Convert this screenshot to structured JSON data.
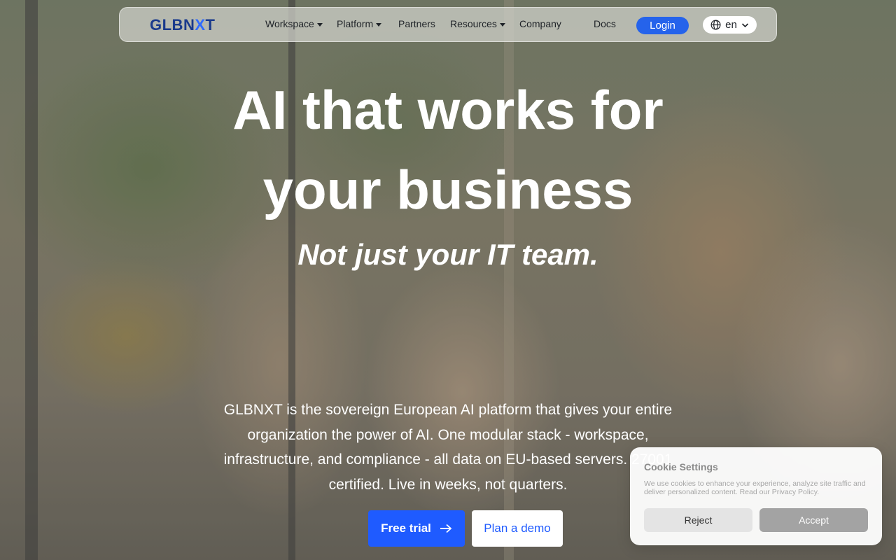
{
  "nav": {
    "logo_main": "GLBN",
    "logo_x": "X",
    "logo_end": "T",
    "items": [
      {
        "label": "Workspace",
        "has_dropdown": true
      },
      {
        "label": "Platform",
        "has_dropdown": true
      },
      {
        "label": "Partners",
        "has_dropdown": false
      },
      {
        "label": "Resources",
        "has_dropdown": true
      },
      {
        "label": "Company",
        "has_dropdown": false
      }
    ],
    "docs_label": "Docs",
    "login_label": "Login",
    "language": "en",
    "accent_color": "#2563eb"
  },
  "hero": {
    "title_line1": "AI that works for",
    "title_line2": "your business",
    "subtitle": "Not just your IT team.",
    "description": "GLBNXT is the sovereign European AI platform that gives your entire organization the power of AI. One modular stack - workspace, infrastructure, and compliance - all data on EU-based servers. 27001 certified. Live in weeks, not quarters.",
    "cta_primary": "Free trial",
    "cta_secondary": "Plan a demo"
  },
  "cookie": {
    "title": "Cookie Settings",
    "text": "We use cookies to enhance your experience, analyze site traffic and deliver personalized content. Read our Privacy Policy.",
    "reject_label": "Reject",
    "accept_label": "Accept"
  }
}
